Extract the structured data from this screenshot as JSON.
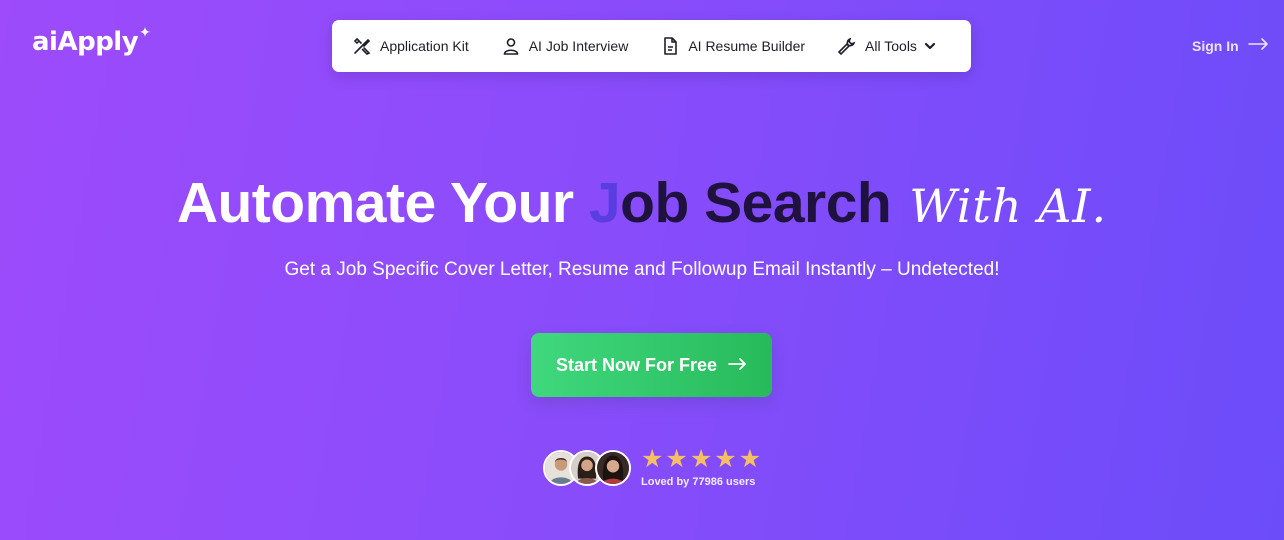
{
  "brand": {
    "name": "aiApply",
    "spark": "✦"
  },
  "nav": {
    "items": [
      {
        "label": "Application Kit",
        "icon": "tools-icon"
      },
      {
        "label": "AI Job Interview",
        "icon": "user-icon"
      },
      {
        "label": "AI Resume Builder",
        "icon": "document-icon"
      },
      {
        "label": "All Tools",
        "icon": "wrench-icon"
      }
    ]
  },
  "signin": {
    "label": "Sign In"
  },
  "hero": {
    "headline_part1": "Automate Your ",
    "headline_faded": "J",
    "headline_dark": "ob Search",
    "headline_script": "With AI.",
    "subtitle": "Get a Job Specific Cover Letter, Resume and Followup Email Instantly – Undetected!"
  },
  "cta": {
    "label": "Start Now For Free"
  },
  "social_proof": {
    "stars": [
      "★",
      "★",
      "★",
      "★",
      "★"
    ],
    "rating": 5,
    "loved_text": "Loved by 77986 users"
  },
  "colors": {
    "cta": "#2fc468",
    "star": "#f5bf63",
    "headline_dark": "#20123f"
  }
}
